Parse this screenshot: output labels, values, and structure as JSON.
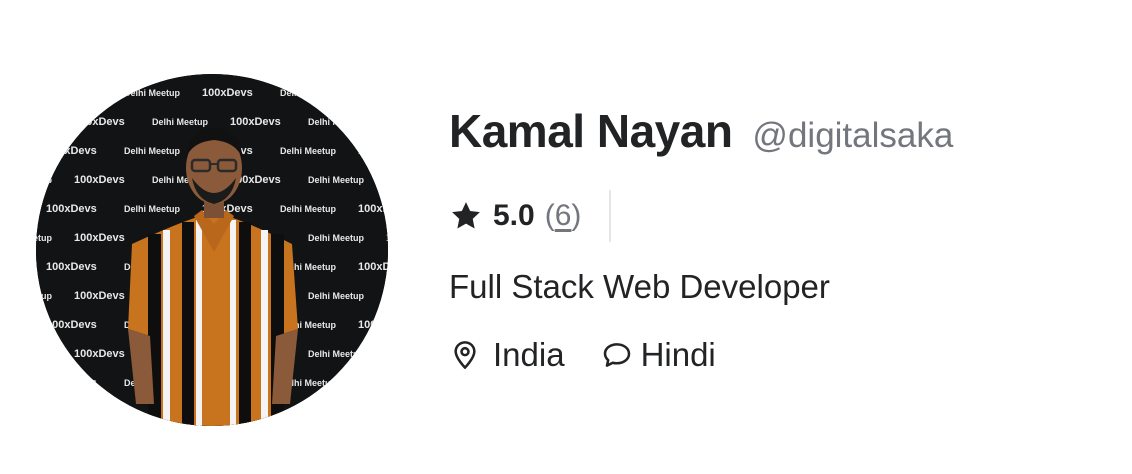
{
  "profile": {
    "name": "Kamal Nayan",
    "username": "@digitalsaka",
    "rating": {
      "value": "5.0",
      "count_open": "(",
      "count": "6",
      "count_close": ")",
      "icon": "star-icon"
    },
    "tagline": "Full Stack Web Developer",
    "location": {
      "icon": "location-pin-icon",
      "label": "India"
    },
    "language": {
      "icon": "chat-bubble-icon",
      "label": "Hindi"
    },
    "avatar": {
      "backdrop_texts": [
        "100xDevs",
        "Delhi Meetup"
      ]
    }
  },
  "colors": {
    "primary_text": "#222325",
    "secondary_text": "#74767e",
    "divider": "#e4e5e7",
    "shirt_orange": "#c8741e",
    "backdrop": "#121314"
  }
}
